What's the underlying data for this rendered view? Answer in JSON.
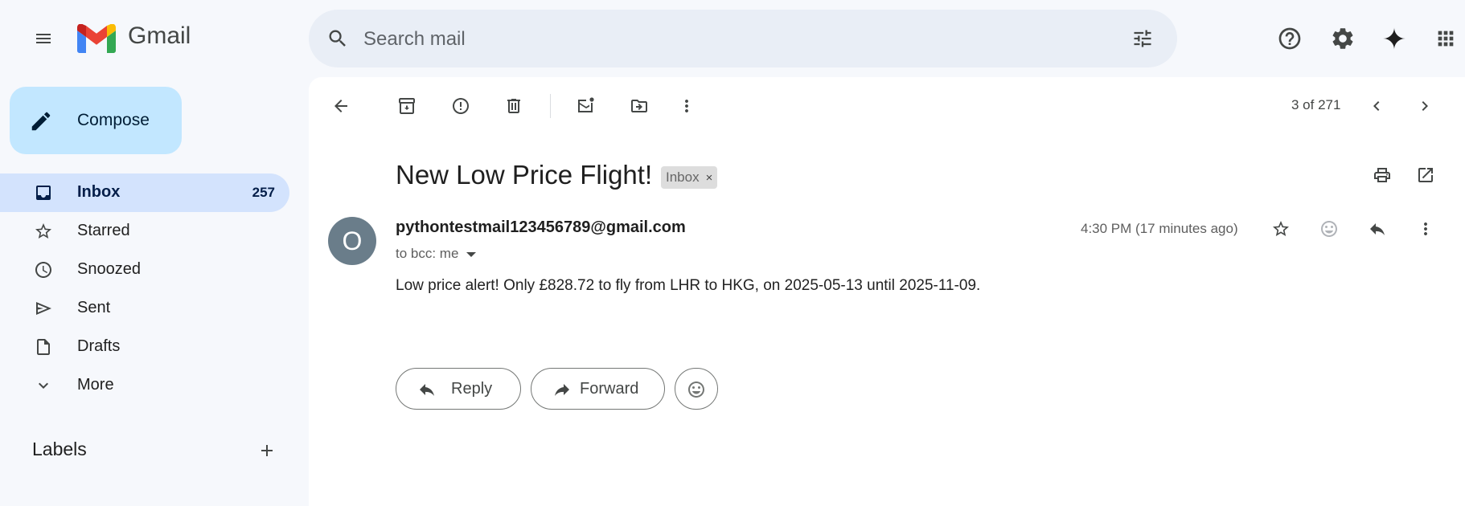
{
  "app": {
    "name": "Gmail",
    "logo_colors": [
      "#4285f4",
      "#ea4335",
      "#fbbc04",
      "#34a853",
      "#c5221f"
    ]
  },
  "header": {
    "search": {
      "placeholder": "Search mail",
      "value": ""
    },
    "icons": [
      "main-menu-icon",
      "search-icon",
      "search-options-icon",
      "help-icon",
      "settings-icon",
      "gemini-icon",
      "apps-icon"
    ]
  },
  "sidebar": {
    "compose_label": "Compose",
    "items": [
      {
        "label": "Inbox",
        "count": "257",
        "icon": "inbox-icon",
        "active": true
      },
      {
        "label": "Starred",
        "count": "",
        "icon": "star-icon",
        "active": false
      },
      {
        "label": "Snoozed",
        "count": "",
        "icon": "clock-icon",
        "active": false
      },
      {
        "label": "Sent",
        "count": "",
        "icon": "send-icon",
        "active": false
      },
      {
        "label": "Drafts",
        "count": "",
        "icon": "draft-icon",
        "active": false
      },
      {
        "label": "More",
        "count": "",
        "icon": "chevron-down-icon",
        "active": false
      }
    ],
    "labels_title": "Labels"
  },
  "toolbar": {
    "icons": [
      "back-icon",
      "archive-icon",
      "report-spam-icon",
      "delete-icon",
      "mark-unread-icon",
      "move-to-icon",
      "more-vert-icon"
    ],
    "pager": "3 of 271"
  },
  "message": {
    "subject": "New Low Price Flight!",
    "label_chip": "Inbox",
    "label_chip_close": "×",
    "avatar_letter": "O",
    "avatar_color": "#6a7d8a",
    "sender": "pythontestmail123456789@gmail.com",
    "recipients": "to bcc: me",
    "timestamp": "4:30 PM (17 minutes ago)",
    "body": "Low price alert! Only £828.72 to fly from LHR to HKG, on 2025-05-13 until 2025-11-09.",
    "reply_label": "Reply",
    "forward_label": "Forward"
  },
  "colors": {
    "background": "#f6f8fc",
    "search_bg": "#e9eef6",
    "compose_bg": "#c2e7ff",
    "active_nav_bg": "#d3e3fd",
    "chip_bg": "#dddddd"
  }
}
